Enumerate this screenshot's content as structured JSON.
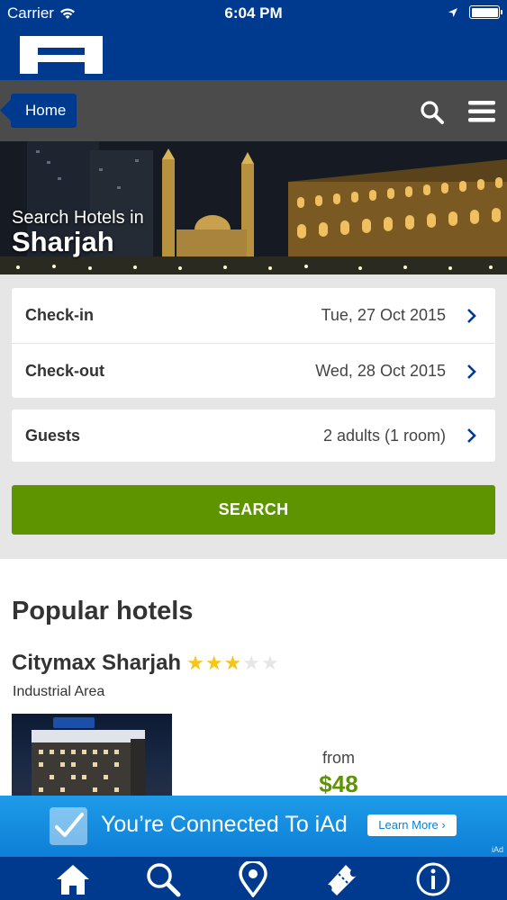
{
  "status_bar": {
    "carrier": "Carrier",
    "time": "6:04 PM",
    "wifi_icon": "wifi-icon",
    "location_icon": "location-arrow-icon",
    "battery_icon": "battery-icon"
  },
  "brand": {
    "logo_icon": "hotel-h-logo-icon"
  },
  "nav": {
    "home_label": "Home",
    "search_icon": "search-icon",
    "menu_icon": "hamburger-menu-icon"
  },
  "hero": {
    "pre_title": "Search Hotels in",
    "city": "Sharjah"
  },
  "search_form": {
    "checkin_label": "Check-in",
    "checkin_value": "Tue, 27 Oct 2015",
    "checkout_label": "Check-out",
    "checkout_value": "Wed, 28 Oct 2015",
    "guests_label": "Guests",
    "guests_value": "2 adults (1 room)",
    "search_label": "SEARCH"
  },
  "popular": {
    "title": "Popular hotels",
    "hotels": [
      {
        "name": "Citymax Sharjah",
        "stars": 3,
        "max_stars": 5,
        "area": "Industrial Area",
        "from_label": "from",
        "price": "$48"
      }
    ]
  },
  "ad": {
    "message": "You’re Connected To iAd",
    "cta": "Learn More ›",
    "badge": "iAd"
  },
  "tabbar": {
    "items": [
      "home-icon",
      "search-icon",
      "map-pin-icon",
      "ticket-icon",
      "info-icon"
    ]
  },
  "colors": {
    "brand_blue": "#003a8f",
    "nav_gray": "#4b4b4b",
    "search_green": "#5e9400",
    "star_gold": "#f5c518",
    "ad_blue": "#0d7fd6"
  }
}
